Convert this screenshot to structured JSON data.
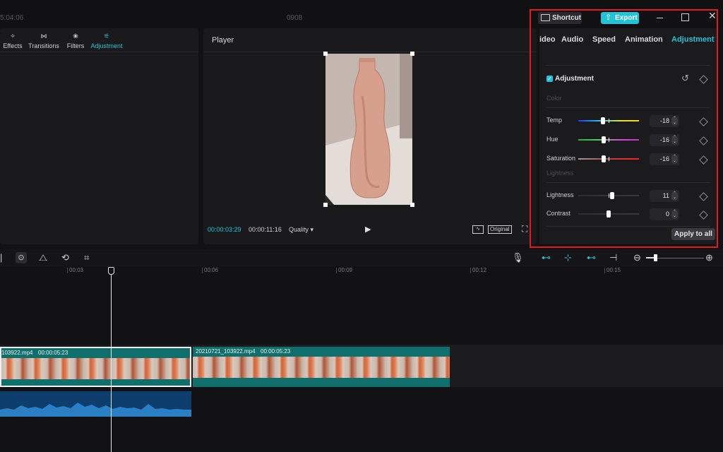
{
  "titlebar": {
    "timecode": "5:04:06",
    "project_name": "0908",
    "shortcut_label": "Shortcut",
    "export_label": "Export"
  },
  "left_toolbar": {
    "tools": [
      {
        "label": "Effects",
        "icon": "effects-icon"
      },
      {
        "label": "Transitions",
        "icon": "transitions-icon"
      },
      {
        "label": "Filters",
        "icon": "filters-icon"
      },
      {
        "label": "Adjustment",
        "icon": "adjustment-icon",
        "active": true
      }
    ]
  },
  "player": {
    "title": "Player",
    "current_time": "00:00:03:29",
    "total_time": "00:00:11:16",
    "quality_label": "Quality",
    "original_label": "Original"
  },
  "settings": {
    "tabs": [
      {
        "label": "ideo"
      },
      {
        "label": "Audio"
      },
      {
        "label": "Speed"
      },
      {
        "label": "Animation"
      },
      {
        "label": "Adjustment",
        "active": true
      }
    ],
    "adjustment_title": "Adjustment",
    "adjustment_checked": true,
    "color_group": "Color",
    "lightness_group": "Lightness",
    "rows": [
      {
        "label": "Temp",
        "value": "-18",
        "level": -18,
        "gradient": "linear-gradient(90deg,#2238ff,#1fc1ff,#d9e44a,#ffd400)"
      },
      {
        "label": "Hue",
        "value": "-16",
        "level": -16,
        "gradient": "linear-gradient(90deg,#1fb33a,#4cd05c,#d94bd9,#c236c2)"
      },
      {
        "label": "Saturation",
        "value": "-16",
        "level": -16,
        "gradient": "linear-gradient(90deg,#9a9a9a,#c04040,#ff2020)"
      },
      {
        "label": "Lightness",
        "value": "11",
        "level": 11,
        "gradient": "linear-gradient(90deg,#2e2e32,#3a3a3e)"
      },
      {
        "label": "Contrast",
        "value": "0",
        "level": 0,
        "gradient": "linear-gradient(90deg,#2e2e32,#3a3a3e)"
      }
    ],
    "apply_all_label": "Apply to all"
  },
  "timeline": {
    "ruler_labels": [
      "00:03",
      "00:06",
      "00:09",
      "00:12",
      "00:15"
    ],
    "clips": [
      {
        "name": "103922.mp4",
        "duration": "00:00:05:23"
      },
      {
        "name": "20210721_103922.mp4",
        "duration": "00:00:05:23"
      }
    ]
  },
  "colors": {
    "accent": "#22c3d6",
    "highlight": "#e01b24",
    "clip": "#0f6f6c"
  }
}
